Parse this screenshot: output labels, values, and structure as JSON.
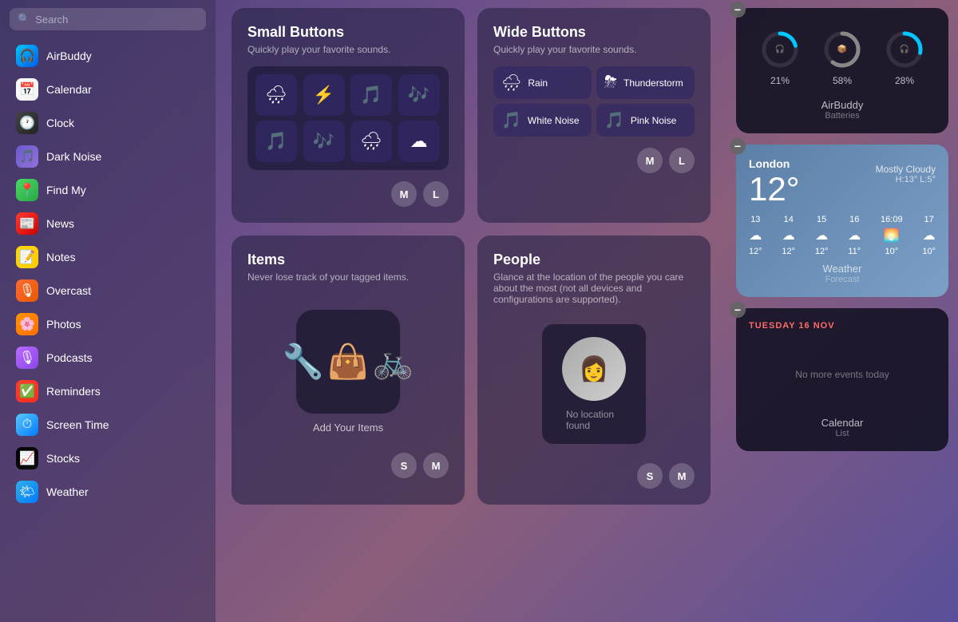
{
  "sidebar": {
    "search": {
      "placeholder": "Search"
    },
    "items": [
      {
        "id": "airbuddy",
        "label": "AirBuddy",
        "icon": "🎧",
        "iconClass": "icon-airbuddy"
      },
      {
        "id": "calendar",
        "label": "Calendar",
        "icon": "📅",
        "iconClass": "icon-calendar"
      },
      {
        "id": "clock",
        "label": "Clock",
        "icon": "🕐",
        "iconClass": "icon-clock"
      },
      {
        "id": "darknoise",
        "label": "Dark Noise",
        "icon": "🎵",
        "iconClass": "icon-darknoise"
      },
      {
        "id": "findmy",
        "label": "Find My",
        "icon": "📍",
        "iconClass": "icon-findmy"
      },
      {
        "id": "news",
        "label": "News",
        "icon": "📰",
        "iconClass": "icon-news"
      },
      {
        "id": "notes",
        "label": "Notes",
        "icon": "📝",
        "iconClass": "icon-notes"
      },
      {
        "id": "overcast",
        "label": "Overcast",
        "icon": "🎙",
        "iconClass": "icon-overcast"
      },
      {
        "id": "photos",
        "label": "Photos",
        "icon": "🌸",
        "iconClass": "icon-photos"
      },
      {
        "id": "podcasts",
        "label": "Podcasts",
        "icon": "🎙",
        "iconClass": "icon-podcasts"
      },
      {
        "id": "reminders",
        "label": "Reminders",
        "icon": "✅",
        "iconClass": "icon-reminders"
      },
      {
        "id": "screentime",
        "label": "Screen Time",
        "icon": "⏱",
        "iconClass": "icon-screentime"
      },
      {
        "id": "stocks",
        "label": "Stocks",
        "icon": "📈",
        "iconClass": "icon-stocks"
      },
      {
        "id": "weather",
        "label": "Weather",
        "icon": "🌤",
        "iconClass": "icon-weather"
      }
    ]
  },
  "widgets": {
    "smallButtons": {
      "title": "Small Buttons",
      "subtitle": "Quickly play your favorite sounds.",
      "sounds": [
        "🌧",
        "⚡",
        "🎵",
        "🎶",
        "🎵",
        "🎶",
        "🌧",
        "☁"
      ]
    },
    "wideButtons": {
      "title": "Wide Buttons",
      "subtitle": "Quickly play your favorite sounds.",
      "buttons": [
        {
          "icon": "🌧",
          "label": "Rain"
        },
        {
          "icon": "⛈",
          "label": "Thunderstorm"
        },
        {
          "icon": "🎵",
          "label": "White Noise"
        },
        {
          "icon": "🎵",
          "label": "Pink Noise"
        }
      ]
    },
    "items": {
      "title": "Items",
      "subtitle": "Never lose track of your tagged items.",
      "addLabel": "Add Your Items",
      "icons": [
        "🔧",
        "👜",
        "🚲"
      ]
    },
    "people": {
      "title": "People",
      "subtitle": "Glance at the location of the people you care about the most (not all devices and configurations are supported).",
      "noLocationText": "No location found"
    }
  },
  "rightPanel": {
    "airbuddy": {
      "circles": [
        {
          "percent": 21,
          "color": "#00c6fb",
          "icon": "🎧"
        },
        {
          "percent": 58,
          "color": "#888",
          "icon": "📦"
        },
        {
          "percent": 28,
          "color": "#00c6fb",
          "icon": "🎧"
        }
      ],
      "title": "AirBuddy",
      "subtitle": "Batteries"
    },
    "weather": {
      "location": "London",
      "temp": "12°",
      "condition": "Mostly Cloudy",
      "high": "H:13°",
      "low": "L:5°",
      "forecast": [
        {
          "day": "13",
          "icon": "☁",
          "temp": "12°"
        },
        {
          "day": "14",
          "icon": "☁",
          "temp": "12°"
        },
        {
          "day": "15",
          "icon": "☁",
          "temp": "12°"
        },
        {
          "day": "16",
          "icon": "☁",
          "temp": "11°"
        },
        {
          "day": "16:09",
          "icon": "🌅",
          "temp": "10°"
        },
        {
          "day": "17",
          "icon": "☁",
          "temp": "10°"
        }
      ],
      "title": "Weather",
      "subtitle": "Forecast"
    },
    "calendar": {
      "dateLabel": "TUESDAY 16 NOV",
      "noEventsText": "No more events today",
      "title": "Calendar",
      "subtitle": "List"
    }
  },
  "avatars": {
    "m": "M",
    "l": "L",
    "s": "S"
  }
}
